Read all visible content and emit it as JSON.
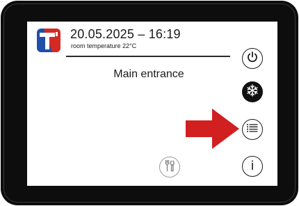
{
  "header": {
    "datetime": "20.05.2025 – 16:19",
    "room_temperature": "room temperature 22°C"
  },
  "main": {
    "title": "Main entrance"
  },
  "side_buttons": [
    {
      "icon": "power-icon"
    },
    {
      "icon": "snowflake-icon"
    },
    {
      "icon": "menu-icon"
    },
    {
      "icon": "info-icon",
      "glyph": "i"
    }
  ],
  "footer": {
    "service_icon": "tools-icon"
  },
  "colors": {
    "bezel": "#0d0d0d",
    "screen": "#ffffff",
    "arrow": "#d21f1f",
    "logo_blue": "#1f4fa8",
    "logo_red": "#d42a24"
  }
}
